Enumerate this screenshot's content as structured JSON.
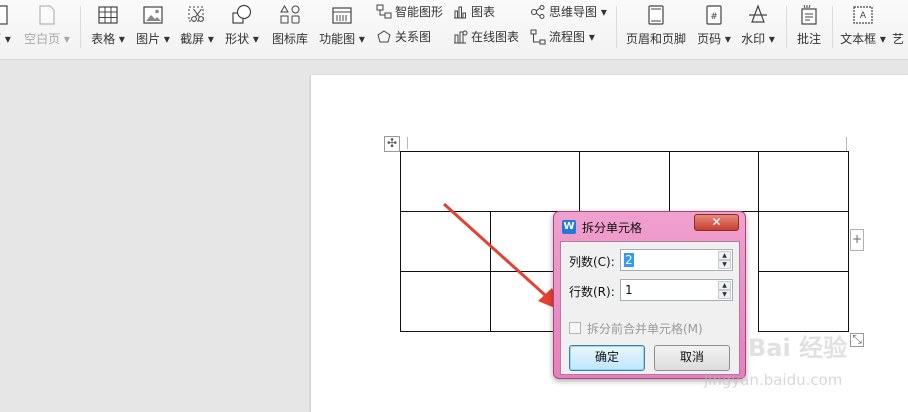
{
  "ribbon": {
    "tools": [
      {
        "id": "page-partial",
        "label": "页 ▾",
        "icon": "page-icon",
        "disabled": false
      },
      {
        "id": "blank-page",
        "label": "空白页 ▾",
        "icon": "blank-page-icon",
        "disabled": true
      },
      {
        "id": "table",
        "label": "表格 ▾",
        "icon": "table-icon",
        "disabled": false
      },
      {
        "id": "picture",
        "label": "图片 ▾",
        "icon": "picture-icon",
        "disabled": false
      },
      {
        "id": "screenshot",
        "label": "截屏 ▾",
        "icon": "screenshot-icon",
        "disabled": false
      },
      {
        "id": "shape",
        "label": "形状 ▾",
        "icon": "shape-icon",
        "disabled": false
      },
      {
        "id": "icon-lib",
        "label": "图标库",
        "icon": "icon-library-icon",
        "disabled": false
      },
      {
        "id": "function-chart",
        "label": "功能图 ▾",
        "icon": "function-chart-icon",
        "disabled": false
      },
      {
        "id": "header-footer",
        "label": "页眉和页脚",
        "icon": "header-footer-icon",
        "disabled": false
      },
      {
        "id": "page-number",
        "label": "页码 ▾",
        "icon": "page-number-icon",
        "disabled": false
      },
      {
        "id": "watermark",
        "label": "水印 ▾",
        "icon": "watermark-icon",
        "disabled": false
      },
      {
        "id": "comment",
        "label": "批注",
        "icon": "comment-icon",
        "disabled": false
      },
      {
        "id": "textbox",
        "label": "文本框 ▾",
        "icon": "textbox-icon",
        "disabled": false
      },
      {
        "id": "art",
        "label": "艺",
        "icon": "art-text-icon",
        "disabled": false
      }
    ],
    "small_tools": [
      {
        "id": "smart-graphic",
        "label": "智能图形",
        "icon": "smart-graphic-icon"
      },
      {
        "id": "chart",
        "label": "图表",
        "icon": "chart-icon"
      },
      {
        "id": "mind-map",
        "label": "思维导图 ▾",
        "icon": "mind-map-icon"
      },
      {
        "id": "relation-graph",
        "label": "关系图",
        "icon": "relation-graph-icon"
      },
      {
        "id": "online-chart",
        "label": "在线图表",
        "icon": "online-chart-icon"
      },
      {
        "id": "flowchart",
        "label": "流程图 ▾",
        "icon": "flowchart-icon"
      }
    ]
  },
  "document": {
    "move_handle": "✣",
    "add_row": "+",
    "resize_handle": "⤡"
  },
  "dialog": {
    "title": "拆分单元格",
    "logo": "W",
    "close_label": "✕",
    "columns_label": "列数(C):",
    "columns_value": "2",
    "rows_label": "行数(R):",
    "rows_value": "1",
    "merge_before_split_label": "拆分前合并单元格(M)",
    "ok_label": "确定",
    "cancel_label": "取消"
  },
  "watermark": {
    "brand": "Bai 经验",
    "url": "jingyan.baidu.com"
  },
  "colors": {
    "dialog_frame": "#e77fbf",
    "annotation_arrow": "#e8402f",
    "selection": "#3399ff"
  }
}
